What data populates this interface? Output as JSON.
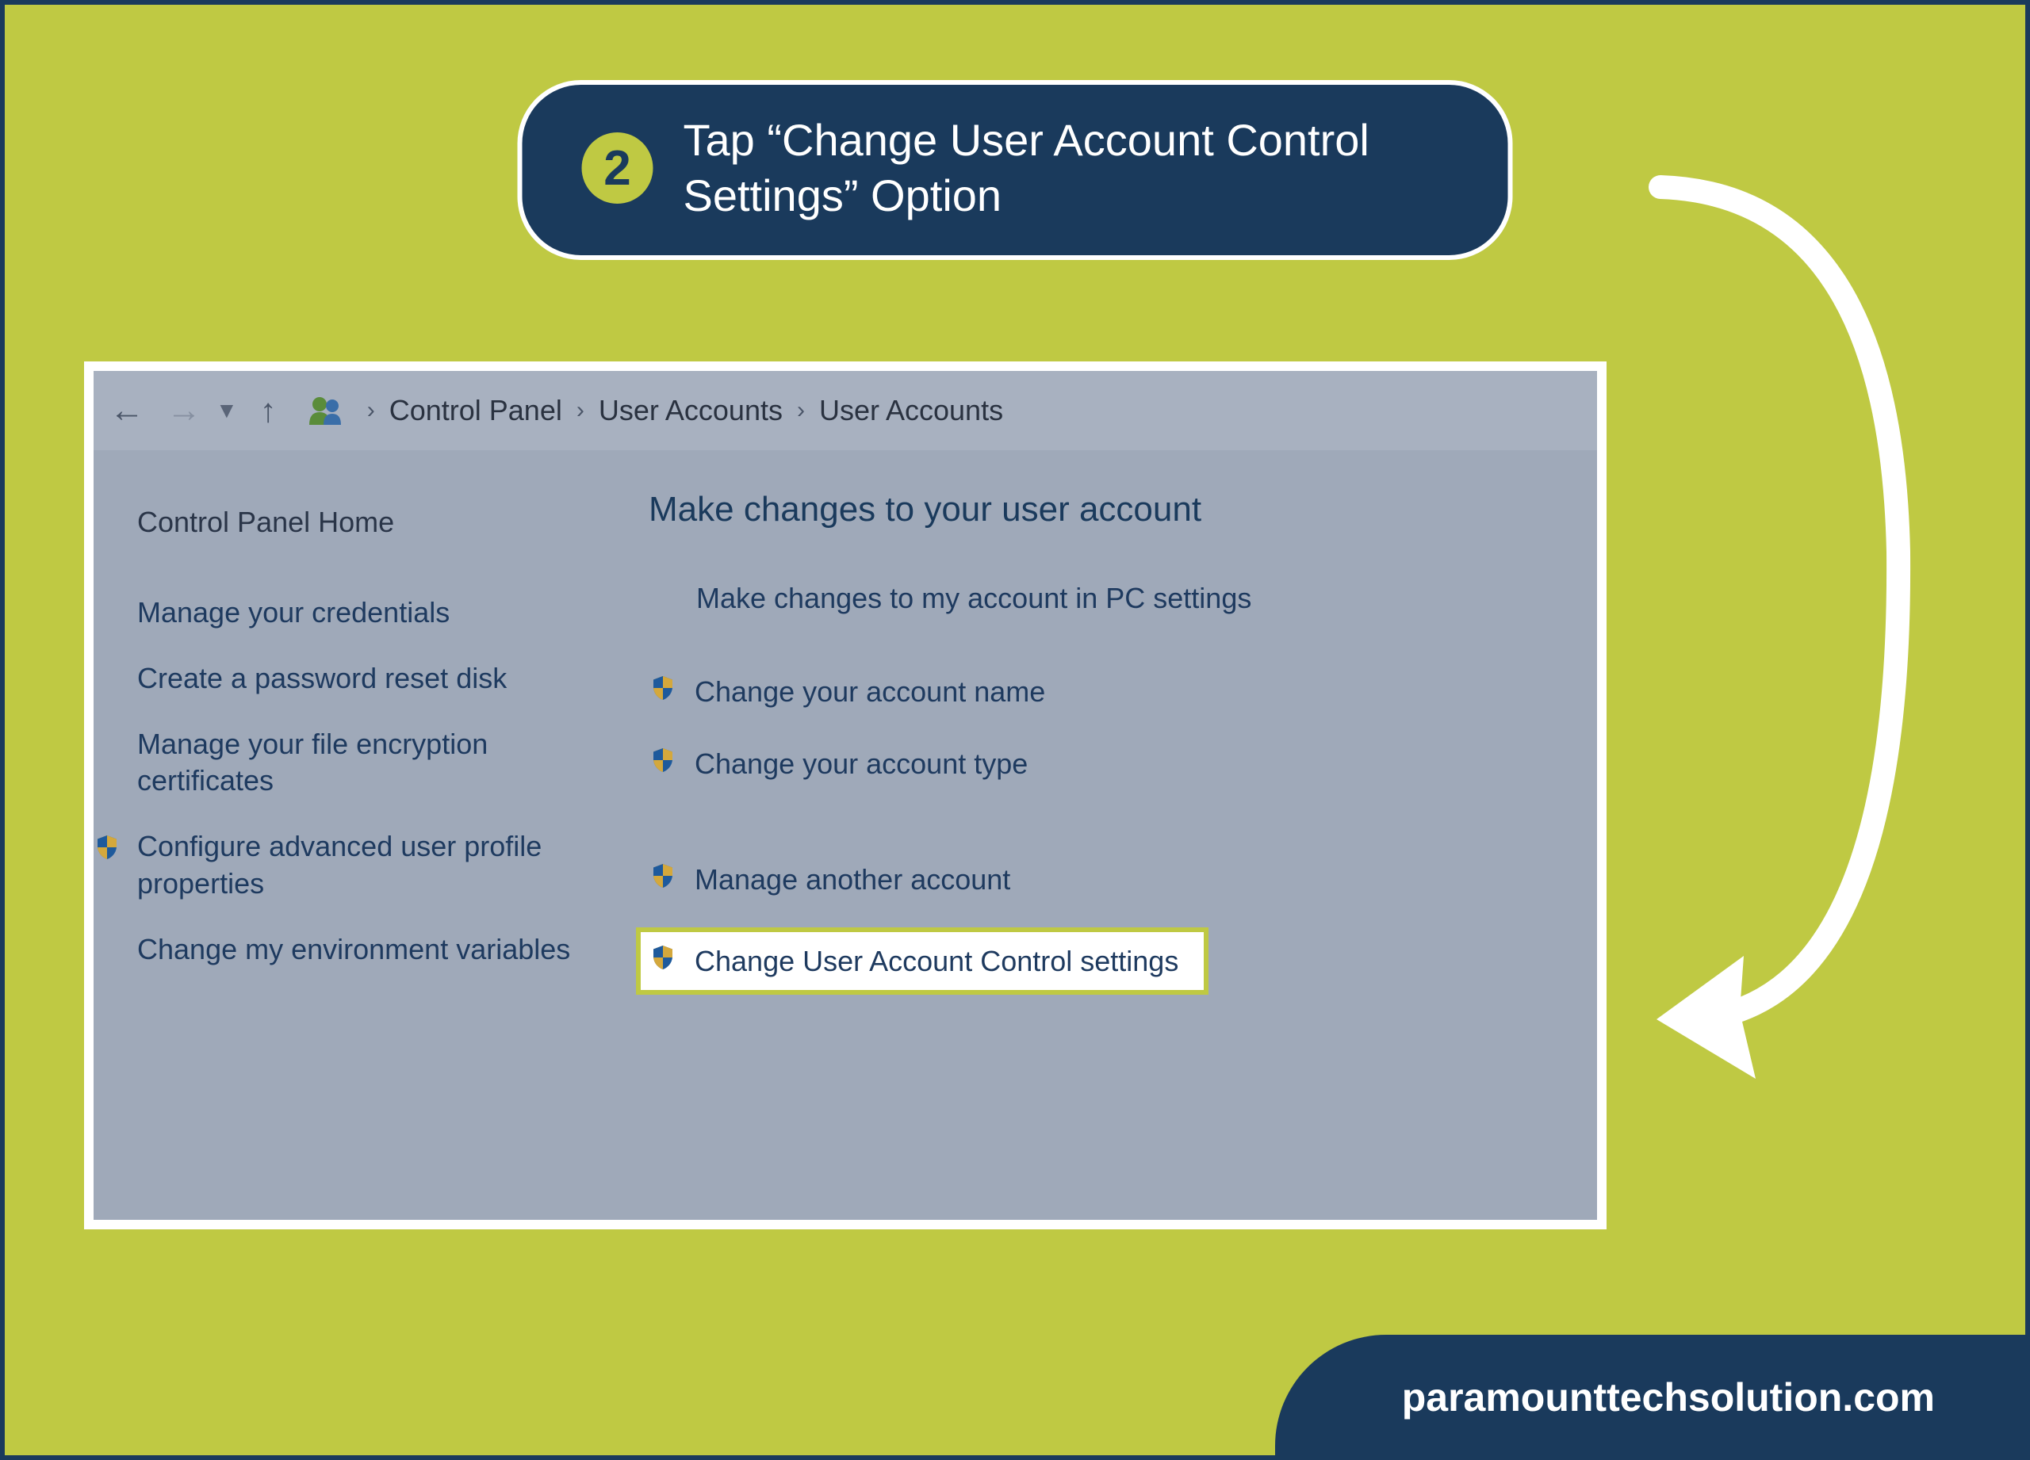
{
  "step": {
    "number": "2",
    "title": "Tap “Change User Account Control Settings” Option"
  },
  "breadcrumb": {
    "items": [
      "Control Panel",
      "User Accounts",
      "User Accounts"
    ]
  },
  "sidebar": {
    "title": "Control Panel Home",
    "links": [
      {
        "label": "Manage your credentials",
        "shield": false
      },
      {
        "label": "Create a password reset disk",
        "shield": false
      },
      {
        "label": "Manage your file encryption certificates",
        "shield": false
      },
      {
        "label": "Configure advanced user profile properties",
        "shield": true
      },
      {
        "label": "Change my environment variables",
        "shield": false
      }
    ]
  },
  "main": {
    "title": "Make changes to your user account",
    "pcSettings": "Make changes to my account in PC settings",
    "links": [
      {
        "label": "Change your account name",
        "highlighted": false
      },
      {
        "label": "Change your account type",
        "highlighted": false
      }
    ],
    "links2": [
      {
        "label": "Manage another account",
        "highlighted": false
      },
      {
        "label": "Change User Account Control settings",
        "highlighted": true
      }
    ]
  },
  "footer": {
    "site": "paramounttechsolution.com"
  }
}
